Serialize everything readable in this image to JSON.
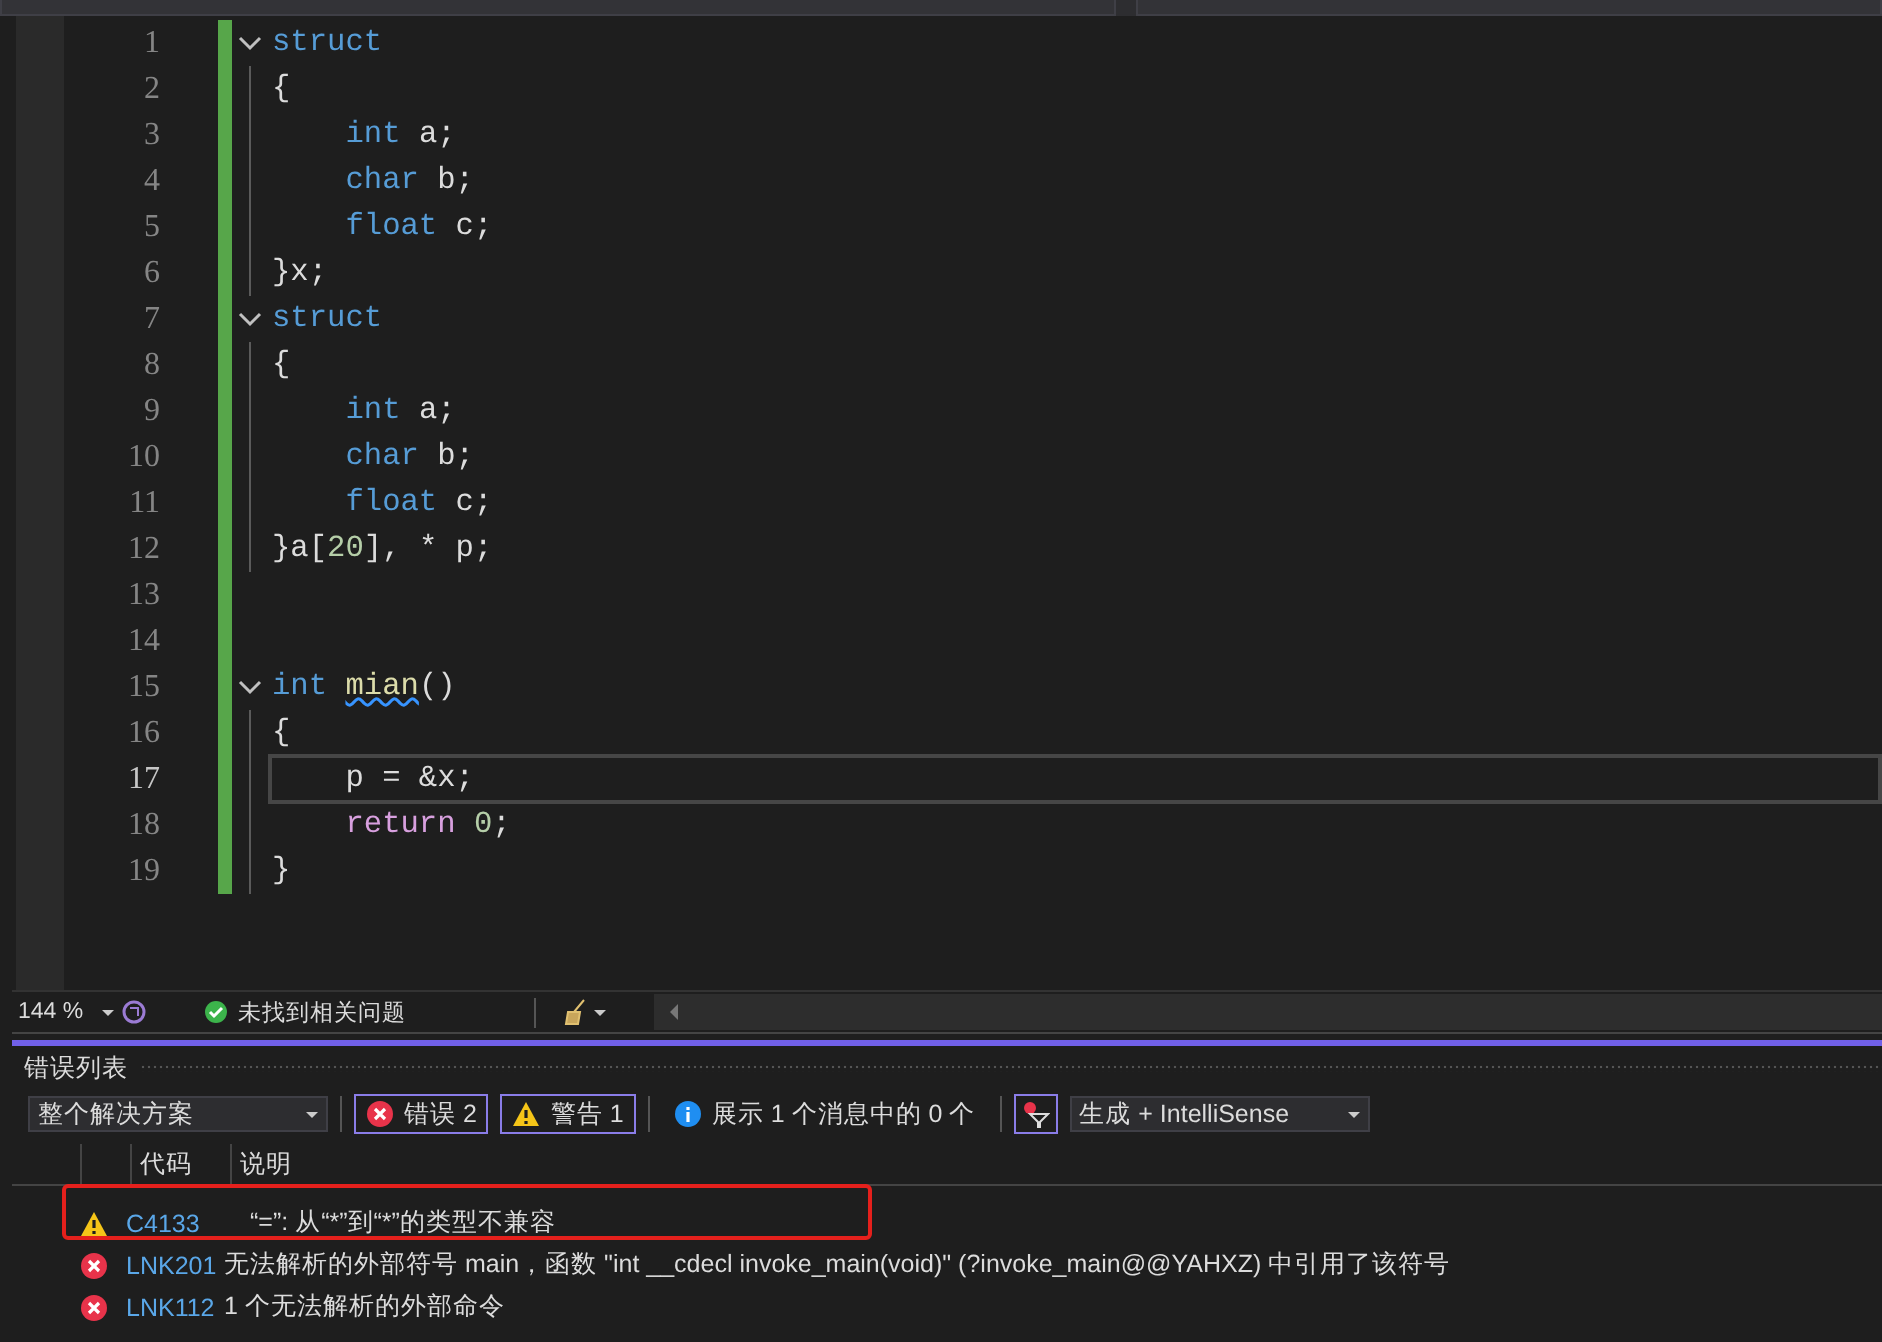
{
  "editor": {
    "lines": [
      {
        "number": "1",
        "fold": true,
        "current": false,
        "tokens": [
          {
            "kind": "keyword",
            "text": "struct"
          }
        ]
      },
      {
        "number": "2",
        "fold": false,
        "current": false,
        "tokens": [
          {
            "kind": "plain",
            "text": "{"
          }
        ]
      },
      {
        "number": "3",
        "fold": false,
        "current": false,
        "tokens": [
          {
            "kind": "keyword",
            "text": "    int"
          },
          {
            "kind": "plain",
            "text": " a;"
          }
        ]
      },
      {
        "number": "4",
        "fold": false,
        "current": false,
        "tokens": [
          {
            "kind": "keyword",
            "text": "    char"
          },
          {
            "kind": "plain",
            "text": " b;"
          }
        ]
      },
      {
        "number": "5",
        "fold": false,
        "current": false,
        "tokens": [
          {
            "kind": "keyword",
            "text": "    float"
          },
          {
            "kind": "plain",
            "text": " c;"
          }
        ]
      },
      {
        "number": "6",
        "fold": false,
        "current": false,
        "tokens": [
          {
            "kind": "plain",
            "text": "}x;"
          }
        ]
      },
      {
        "number": "7",
        "fold": true,
        "current": false,
        "tokens": [
          {
            "kind": "keyword",
            "text": "struct"
          }
        ]
      },
      {
        "number": "8",
        "fold": false,
        "current": false,
        "tokens": [
          {
            "kind": "plain",
            "text": "{"
          }
        ]
      },
      {
        "number": "9",
        "fold": false,
        "current": false,
        "tokens": [
          {
            "kind": "keyword",
            "text": "    int"
          },
          {
            "kind": "plain",
            "text": " a;"
          }
        ]
      },
      {
        "number": "10",
        "fold": false,
        "current": false,
        "tokens": [
          {
            "kind": "keyword",
            "text": "    char"
          },
          {
            "kind": "plain",
            "text": " b;"
          }
        ]
      },
      {
        "number": "11",
        "fold": false,
        "current": false,
        "tokens": [
          {
            "kind": "keyword",
            "text": "    float"
          },
          {
            "kind": "plain",
            "text": " c;"
          }
        ]
      },
      {
        "number": "12",
        "fold": false,
        "current": false,
        "tokens": [
          {
            "kind": "plain",
            "text": "}a["
          },
          {
            "kind": "number",
            "text": "20"
          },
          {
            "kind": "plain",
            "text": "], * p;"
          }
        ]
      },
      {
        "number": "13",
        "fold": false,
        "current": false
      },
      {
        "number": "14",
        "fold": false,
        "current": false
      },
      {
        "number": "15",
        "fold": true,
        "current": false,
        "tokens": [
          {
            "kind": "keyword",
            "text": "int "
          },
          {
            "kind": "function",
            "text": "mian",
            "squiggle": true
          },
          {
            "kind": "plain",
            "text": "()"
          }
        ]
      },
      {
        "number": "16",
        "fold": false,
        "current": false,
        "tokens": [
          {
            "kind": "plain",
            "text": "{"
          }
        ]
      },
      {
        "number": "17",
        "fold": false,
        "current": true,
        "tokens": [
          {
            "kind": "plain",
            "text": "    p = &x;"
          }
        ]
      },
      {
        "number": "18",
        "fold": false,
        "current": false,
        "tokens": [
          {
            "kind": "control",
            "text": "    return"
          },
          {
            "kind": "number",
            "text": " 0"
          },
          {
            "kind": "plain",
            "text": ";"
          }
        ]
      },
      {
        "number": "19",
        "fold": false,
        "current": false,
        "tokens": [
          {
            "kind": "plain",
            "text": "}"
          }
        ]
      }
    ]
  },
  "status_bar": {
    "zoom": "144 %",
    "issues": "未找到相关问题"
  },
  "error_list": {
    "title": "错误列表",
    "scope": "整个解决方案",
    "filters": [
      {
        "kind": "error",
        "label": "错误 2",
        "selected": true
      },
      {
        "kind": "warning",
        "label": "警告 1",
        "selected": true
      },
      {
        "kind": "info",
        "label": "展示 1 个消息中的 0 个",
        "selected": false
      }
    ],
    "source": "生成 + IntelliSense",
    "columns": [
      "代码",
      "说明"
    ],
    "rows": [
      {
        "kind": "warning",
        "code": "C4133",
        "description": "“=”: 从“*”到“*”的类型不兼容",
        "annotated": true
      },
      {
        "kind": "error",
        "code": "LNK201",
        "description": "无法解析的外部符号 main，函数 \"int __cdecl invoke_main(void)\" (?invoke_main@@YAHXZ) 中引用了该符号",
        "annotated": false
      },
      {
        "kind": "error",
        "code": "LNK112",
        "description": "1 个无法解析的外部命令",
        "annotated": false
      }
    ]
  }
}
